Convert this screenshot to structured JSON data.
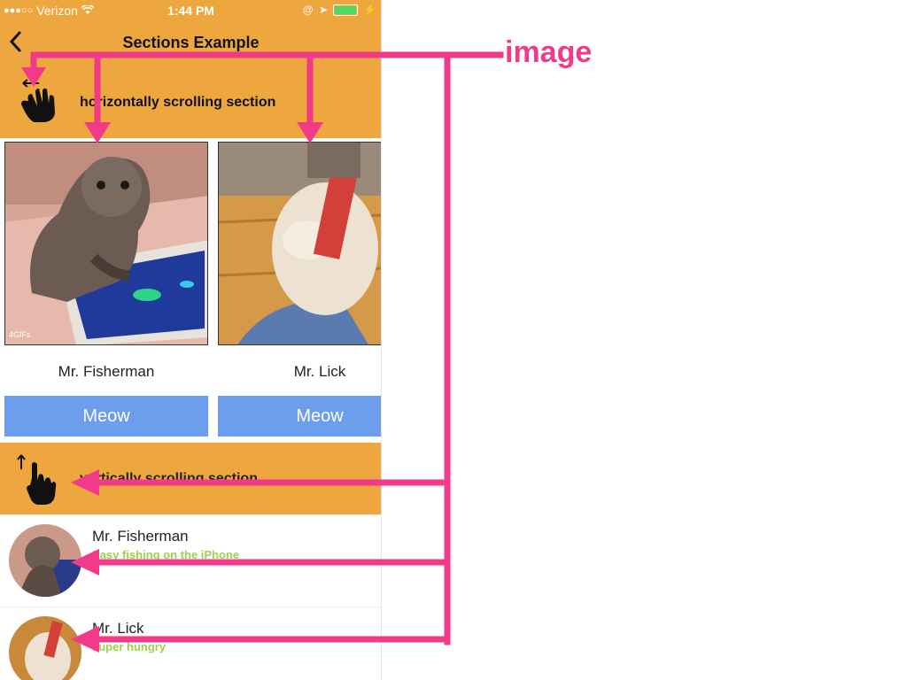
{
  "status_bar": {
    "carrier": "Verizon",
    "time": "1:44 PM"
  },
  "nav": {
    "title": "Sections Example"
  },
  "horizontal_section": {
    "title": "horizontally scrolling section",
    "cards": [
      {
        "name": "Mr. Fisherman",
        "button": "Meow"
      },
      {
        "name": "Mr. Lick",
        "button": "Meow"
      }
    ]
  },
  "vertical_section": {
    "title": "vertically scrolling section",
    "rows": [
      {
        "name": "Mr. Fisherman",
        "subtitle": "Easy fishing on the iPhone"
      },
      {
        "name": "Mr. Lick",
        "subtitle": "super hungry"
      }
    ]
  },
  "annotation": {
    "label": "image",
    "color": "#f23a8a"
  },
  "colors": {
    "header_orange": "#eea73f",
    "button_blue": "#6d9ded",
    "subtitle_green": "#9bd44a"
  }
}
